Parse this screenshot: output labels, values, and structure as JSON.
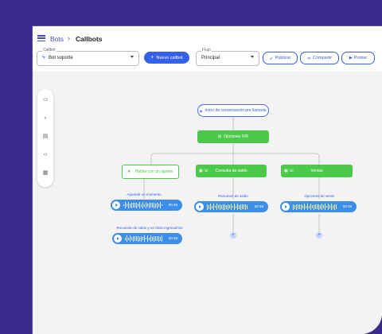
{
  "breadcrumb": {
    "parent": "Bots",
    "separator": "›",
    "current": "Callbots"
  },
  "toolbar": {
    "callbot": {
      "label": "Callbot",
      "value": "Bot soporte"
    },
    "new_button": "Nuevo callbot",
    "flow": {
      "label": "Flujo",
      "value": "Principal"
    },
    "publish": "Publicar",
    "share": "Compartir",
    "test": "Probar"
  },
  "flow": {
    "start": "Inicio de conversación por llamada",
    "options": "Opciones IVR",
    "branches": [
      {
        "label": "Hablar con un agente",
        "caption": "Aguarde un momento",
        "duration": "00:40",
        "caption2": "Recuerde de saldo y un título ingresamos",
        "duration2": "00:45"
      },
      {
        "label": "Consulta de saldo",
        "caption": "Resumen de saldo",
        "duration": "00:45"
      },
      {
        "label": "Ventas",
        "caption": "Opciones de venta",
        "duration": "00:45"
      }
    ]
  },
  "colors": {
    "brand": "#3461e8",
    "frame": "#3b2a8c",
    "node_green": "#4bc94a",
    "audio": "#3c8ee8"
  }
}
